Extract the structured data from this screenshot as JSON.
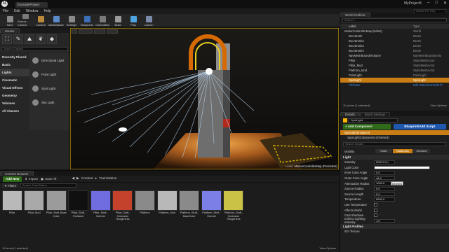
{
  "window": {
    "tab": "ExampleProject",
    "project": "MyProject5",
    "search_hint": "Search For Help"
  },
  "menu": [
    "File",
    "Edit",
    "Window",
    "Help"
  ],
  "toolbar": [
    {
      "label": "Save",
      "icon": "save-icon",
      "color": "#8a8a8a"
    },
    {
      "label": "Source Control",
      "icon": "source-control-icon",
      "color": "#7a7a7a"
    },
    {
      "label": "Content",
      "icon": "content-icon",
      "color": "#b98a3a"
    },
    {
      "label": "Marketplace",
      "icon": "marketplace-icon",
      "color": "#5a8ac8"
    },
    {
      "label": "Settings",
      "icon": "settings-icon",
      "color": "#8a8a8a"
    },
    {
      "label": "Blueprints",
      "icon": "blueprints-icon",
      "color": "#3a6fb8"
    },
    {
      "label": "Cinematics",
      "icon": "cinematics-icon",
      "color": "#7a7a7a"
    },
    {
      "label": "Build",
      "icon": "build-icon",
      "color": "#9a9a9a"
    },
    {
      "label": "Play",
      "icon": "play-icon",
      "color": "#4fa3e0"
    },
    {
      "label": "Launch",
      "icon": "launch-icon",
      "color": "#7a8aa8"
    }
  ],
  "modes": {
    "tab": "Modes",
    "search_placeholder": "Search Classes",
    "categories": [
      "Recently Placed",
      "Basic",
      "Lights",
      "Cinematic",
      "Visual Effects",
      "Geometry",
      "Volumes",
      "All Classes"
    ],
    "selected_category": "Lights",
    "items": [
      "Directional Light",
      "Point Light",
      "Spot Light",
      "Sky Light"
    ]
  },
  "viewport": {
    "level_label": "Level:",
    "level_name": "MotionControllerMap (Persistent)"
  },
  "outliner": {
    "title": "World Outliner",
    "search_placeholder": "Search...",
    "col_label": "Label",
    "col_type": "Type",
    "rows": [
      {
        "label": "MotionControllerMap (Editor)",
        "type": "World",
        "indent": 0
      },
      {
        "label": "Box Brush",
        "type": "Brush",
        "indent": 1
      },
      {
        "label": "Box Brush2",
        "type": "Brush",
        "indent": 1
      },
      {
        "label": "Box Brush3",
        "type": "Brush",
        "indent": 1
      },
      {
        "label": "Box Brush4",
        "type": "Brush",
        "indent": 1
      },
      {
        "label": "NavMeshBoundsVolume",
        "type": "NavMeshBoundsVolu",
        "indent": 1
      },
      {
        "label": "Pillar",
        "type": "StaticMeshActor",
        "indent": 1
      },
      {
        "label": "Pillar_Mod",
        "type": "StaticMeshActor",
        "indent": 1
      },
      {
        "label": "Platform_Mod",
        "type": "StaticMeshActor",
        "indent": 1
      },
      {
        "label": "PointLight",
        "type": "PointLight",
        "indent": 1
      },
      {
        "label": "SpotLight",
        "type": "SpotLight",
        "indent": 1,
        "selected": true
      },
      {
        "label": "VRPawn",
        "type": "Edit MotionControllerP",
        "indent": 1,
        "link": true
      }
    ],
    "status": "11 actors (1 selected)",
    "view_options": "View Options"
  },
  "details": {
    "tab": "Details",
    "tab2": "World Settings",
    "actor_name": "SpotLight",
    "add_component": "+ Add Component",
    "blueprint_btn": "Blueprint/Add Script",
    "instance": "SpotLight(Instance)",
    "component": "SpotLightComponent (Inherited)",
    "search_placeholder": "Search Details",
    "mobility_label": "Mobility",
    "mobility_options": [
      "Static",
      "Stationary",
      "Movable"
    ],
    "section_light": "Light",
    "props": [
      {
        "name": "Intensity",
        "value": "5000.0 lm",
        "kind": "num"
      },
      {
        "name": "Light Color",
        "value": "",
        "kind": "color"
      },
      {
        "name": "Inner Cone Angle",
        "value": "0.0",
        "kind": "num"
      },
      {
        "name": "Outer Cone Angle",
        "value": "44.0",
        "kind": "num"
      },
      {
        "name": "Attenuation Radius",
        "value": "1000.0",
        "kind": "num"
      },
      {
        "name": "Source Radius",
        "value": "0.0",
        "kind": "num"
      },
      {
        "name": "Source Length",
        "value": "0.0",
        "kind": "num"
      },
      {
        "name": "Temperature",
        "value": "6500.0",
        "kind": "num"
      },
      {
        "name": "Use Temperature",
        "value": "",
        "kind": "check"
      },
      {
        "name": "Affects World",
        "value": "",
        "kind": "check"
      },
      {
        "name": "Cast Shadows",
        "value": "",
        "kind": "check"
      },
      {
        "name": "Indirect Lighting Intensity",
        "value": "1.0",
        "kind": "num"
      }
    ],
    "tooltip": "Degrees",
    "section_profiles": "Light Profiles",
    "ies_texture": "IES Texture"
  },
  "content": {
    "tab": "Content Browser",
    "add_new": "Add New",
    "import": "Import",
    "save_all": "Save All",
    "path": [
      "Content",
      "TrainStation"
    ],
    "filters": "Filters",
    "search_placeholder": "Search TrainStation",
    "assets": [
      {
        "name": "Pillar",
        "color": "#b9b9b9"
      },
      {
        "name": "Pillar_Mod",
        "color": "#a9a9a9"
      },
      {
        "name": "Pillar_Stuff_Base Color",
        "color": "#9b9b9b"
      },
      {
        "name": "Pillar_Stuff_ Emissive",
        "color": "#101010"
      },
      {
        "name": "Pillar_Stuff_ Normal",
        "color": "#6f6de0"
      },
      {
        "name": "Pillar_Stuff_ Occlusion Roughness",
        "color": "#c4422c"
      },
      {
        "name": "Platform",
        "color": "#8a8a8a"
      },
      {
        "name": "Platform_Mod",
        "color": "#b8b8b8"
      },
      {
        "name": "Platform_Stuff_ BaseColor",
        "color": "#8a8a8a"
      },
      {
        "name": "Platform_Stuff_ Normal",
        "color": "#7b7fe6"
      },
      {
        "name": "Platform_Stuff_ Occlusion Roughness",
        "color": "#c9c247"
      }
    ],
    "status": "11 items (1 selected)",
    "view_options": "View Options"
  }
}
